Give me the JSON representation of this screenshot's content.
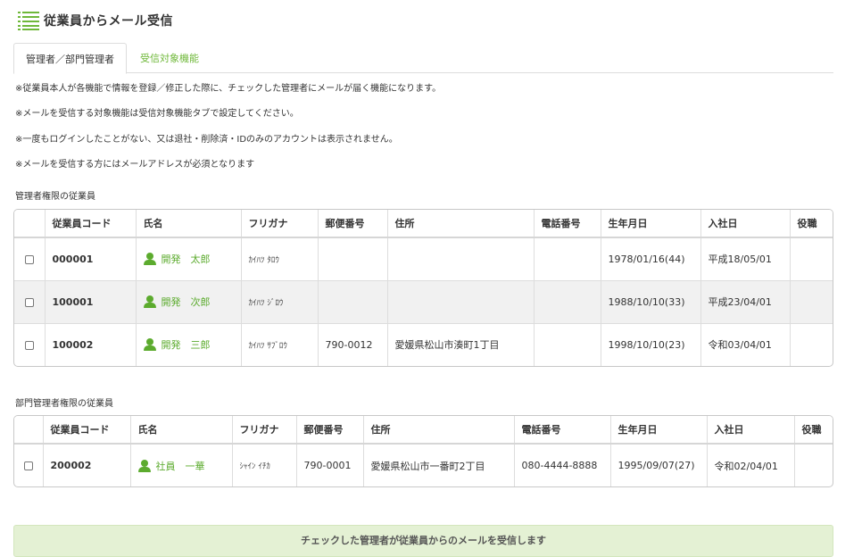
{
  "page": {
    "title": "従業員からメール受信",
    "icon": "list-icon"
  },
  "tabs": [
    {
      "label": "管理者／部門管理者",
      "active": true
    },
    {
      "label": "受信対象機能",
      "active": false
    }
  ],
  "notes": [
    "※従業員本人が各機能で情報を登録／修正した際に、チェックした管理者にメールが届く機能になります。",
    "※メールを受信する対象機能は受信対象機能タブで設定してください。",
    "※一度もログインしたことがない、又は退社・削除済・IDのみのアカウントは表示されません。",
    "※メールを受信する方にはメールアドレスが必須となります"
  ],
  "admins": {
    "label": "管理者権限の従業員",
    "columns": [
      "従業員コード",
      "氏名",
      "フリガナ",
      "郵便番号",
      "住所",
      "電話番号",
      "生年月日",
      "入社日",
      "役職"
    ],
    "rows": [
      {
        "code": "000001",
        "name": "開発　太郎",
        "kana": "ｶｲﾊﾂ ﾀﾛｳ",
        "zip": "",
        "address": "",
        "phone": "",
        "birth": "1978/01/16(44)",
        "joined": "平成18/05/01",
        "position": ""
      },
      {
        "code": "100001",
        "name": "開発　次郎",
        "kana": "ｶｲﾊﾂ ｼﾞﾛｳ",
        "zip": "",
        "address": "",
        "phone": "",
        "birth": "1988/10/10(33)",
        "joined": "平成23/04/01",
        "position": ""
      },
      {
        "code": "100002",
        "name": "開発　三郎",
        "kana": "ｶｲﾊﾂ ｻﾌﾞﾛｳ",
        "zip": "790-0012",
        "address": "愛媛県松山市湊町1丁目",
        "phone": "",
        "birth": "1998/10/10(23)",
        "joined": "令和03/04/01",
        "position": ""
      }
    ]
  },
  "dept_admins": {
    "label": "部門管理者権限の従業員",
    "columns": [
      "従業員コード",
      "氏名",
      "フリガナ",
      "郵便番号",
      "住所",
      "電話番号",
      "生年月日",
      "入社日",
      "役職"
    ],
    "rows": [
      {
        "code": "200002",
        "name": "社員　一華",
        "kana": "ｼｬｲﾝ ｲﾁｶ",
        "zip": "790-0001",
        "address": "愛媛県松山市一番町2丁目",
        "phone": "080-4444-8888",
        "birth": "1995/09/07(27)",
        "joined": "令和02/04/01",
        "position": ""
      }
    ]
  },
  "submit_label": "チェックした管理者が従業員からのメールを受信します",
  "colors": {
    "accent": "#6fb83a",
    "button_bg": "#e4f1d4"
  }
}
